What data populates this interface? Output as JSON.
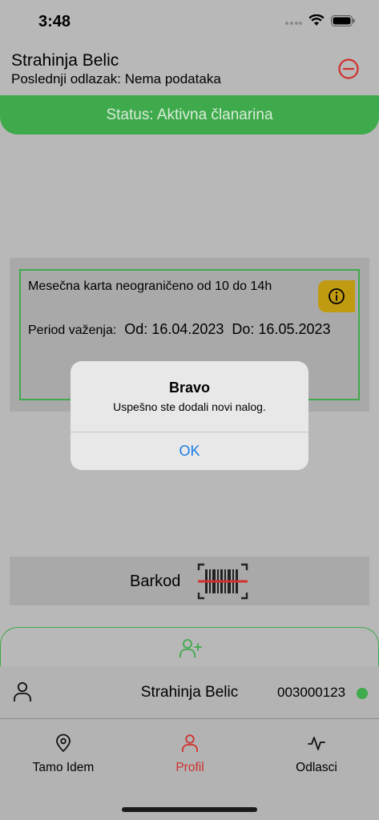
{
  "status_bar": {
    "time": "3:48"
  },
  "header": {
    "user_name": "Strahinja Belic",
    "last_visit": "Poslednji odlazak: Nema podataka",
    "logout_icon": "minus-circle-icon"
  },
  "status": {
    "text": "Status: Aktivna članarina"
  },
  "membership": {
    "plan_name": "Mesečna karta neograničeno od 10 do 14h",
    "period_label": "Period važenja:",
    "from": "Od: 16.04.2023",
    "to": "Do: 16.05.2023"
  },
  "barcode": {
    "label": "Barkod"
  },
  "account": {
    "name": "Strahinja Belic",
    "id": "003000123"
  },
  "tabs": [
    {
      "label": "Tamo Idem",
      "icon": "map-pin-icon"
    },
    {
      "label": "Profil",
      "icon": "person-icon"
    },
    {
      "label": "Odlasci",
      "icon": "activity-icon"
    }
  ],
  "alert": {
    "title": "Bravo",
    "message": "Uspešno ste dodali novi nalog.",
    "ok_label": "OK"
  },
  "colors": {
    "accent_green": "#3faa4c",
    "active_tab_red": "#d0312d",
    "info_yellow": "#c09a10",
    "link_blue": "#1a7ee8"
  }
}
